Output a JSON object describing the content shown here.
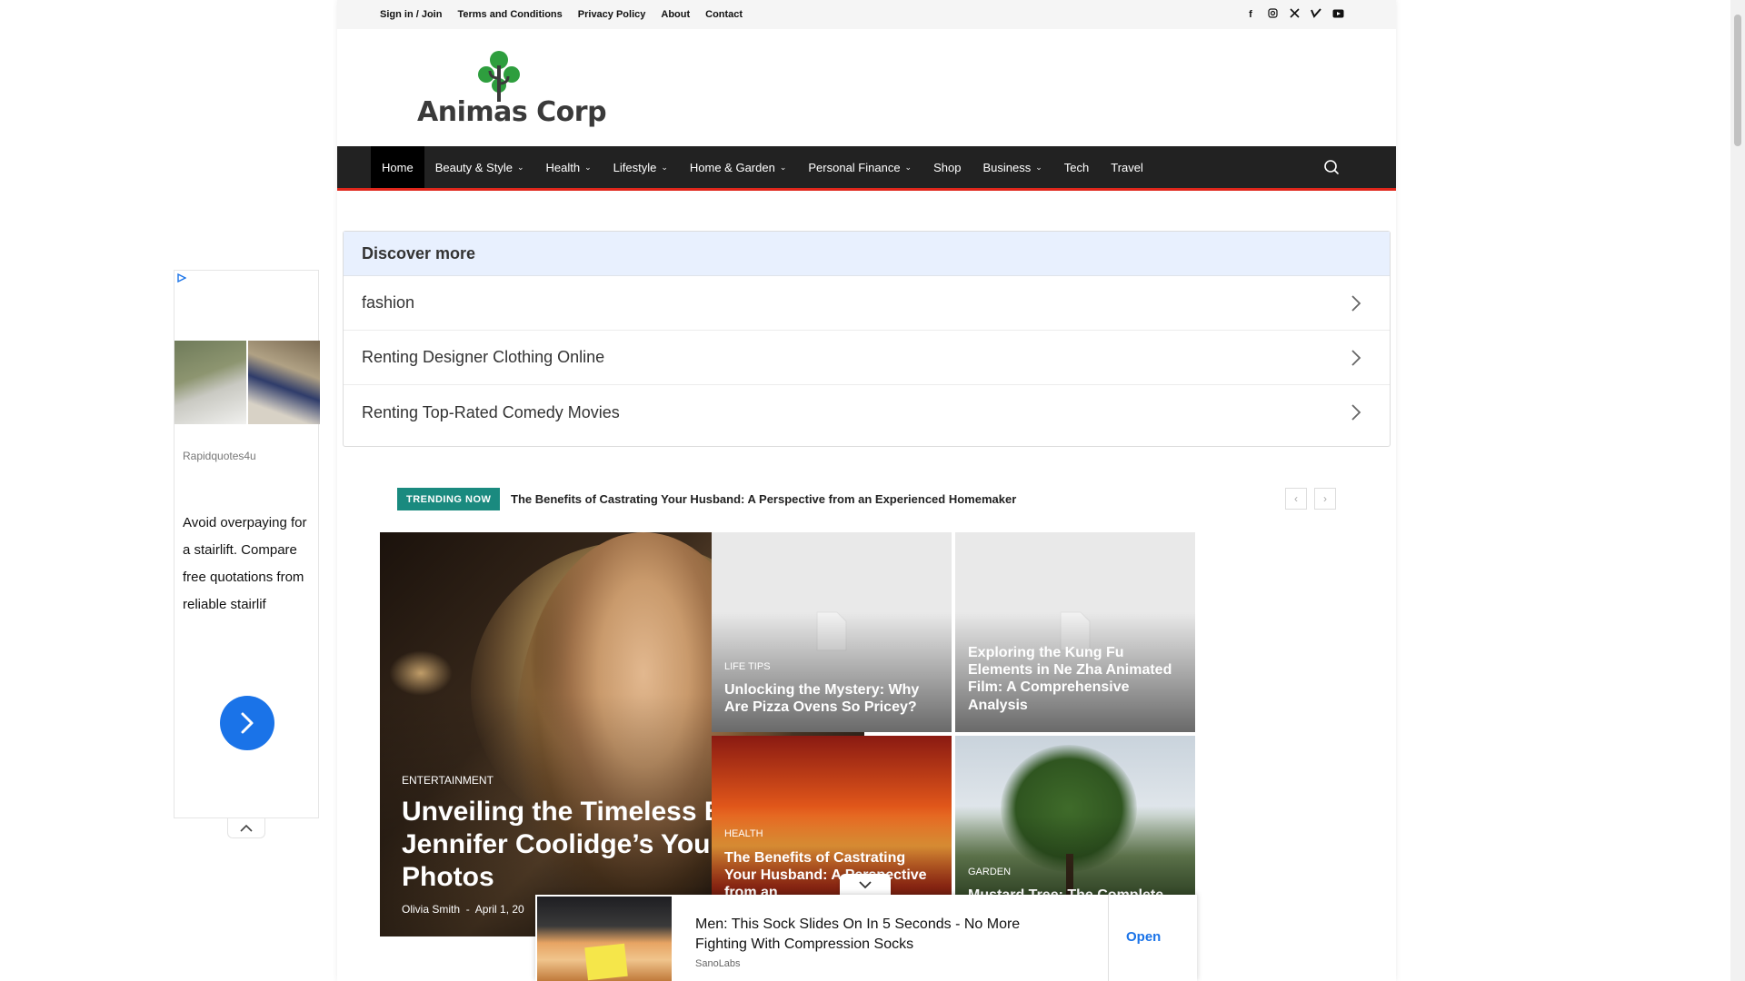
{
  "topbar": {
    "links": [
      "Sign in / Join",
      "Terms and Conditions",
      "Privacy Policy",
      "About",
      "Contact"
    ],
    "socials": [
      "facebook-icon",
      "instagram-icon",
      "x-icon",
      "vimeo-icon",
      "youtube-icon"
    ]
  },
  "logo": {
    "text": "Animas Corp"
  },
  "nav": {
    "items": [
      {
        "label": "Home",
        "dropdown": false,
        "active": true
      },
      {
        "label": "Beauty & Style",
        "dropdown": true
      },
      {
        "label": "Health",
        "dropdown": true
      },
      {
        "label": "Lifestyle",
        "dropdown": true
      },
      {
        "label": "Home & Garden",
        "dropdown": true
      },
      {
        "label": "Personal Finance",
        "dropdown": true
      },
      {
        "label": "Shop",
        "dropdown": false
      },
      {
        "label": "Business",
        "dropdown": true
      },
      {
        "label": "Tech",
        "dropdown": false
      },
      {
        "label": "Travel",
        "dropdown": false
      }
    ],
    "search_icon": "search-icon"
  },
  "discover": {
    "heading": "Discover more",
    "items": [
      "fashion",
      "Renting Designer Clothing Online",
      "Renting Top-Rated Comedy Movies"
    ]
  },
  "trending": {
    "badge": "TRENDING NOW",
    "headline": "The Benefits of Castrating Your Husband: A Perspective from an Experienced Homemaker"
  },
  "featured": {
    "main": {
      "category": "ENTERTAINMENT",
      "title": "Unveiling the Timeless Beauty: Jennifer Coolidge’s Young Photos",
      "author": "Olivia Smith",
      "date": "April 1, 20"
    },
    "tiles": [
      {
        "category": "LIFE TIPS",
        "title": "Unlocking the Mystery: Why Are Pizza Ovens So Pricey?"
      },
      {
        "category": "",
        "title": "Exploring the Kung Fu Elements in Ne Zha Animated Film: A Comprehensive Analysis"
      },
      {
        "category": "HEALTH",
        "title": "The Benefits of Castrating Your Husband: A Perspective from an"
      },
      {
        "category": "GARDEN",
        "title": "Mustard Tree: The Complete"
      }
    ]
  },
  "left_ad": {
    "source": "Rapidquotes4u",
    "copy": "Avoid overpaying for a stairlift. Compare free quotations from reliable stairlif"
  },
  "bottom_ad": {
    "title": "Men: This Sock Slides On In 5 Seconds - No More Fighting With Compression Socks",
    "source": "SanoLabs",
    "cta": "Open"
  },
  "colors": {
    "nav_bg": "#222222",
    "nav_accent": "#e0271c",
    "trending_badge": "#1a8a7f",
    "discover_head": "#e8f0fe",
    "ad_blue": "#1a73e8",
    "logo_green": "#2e9e3e"
  }
}
